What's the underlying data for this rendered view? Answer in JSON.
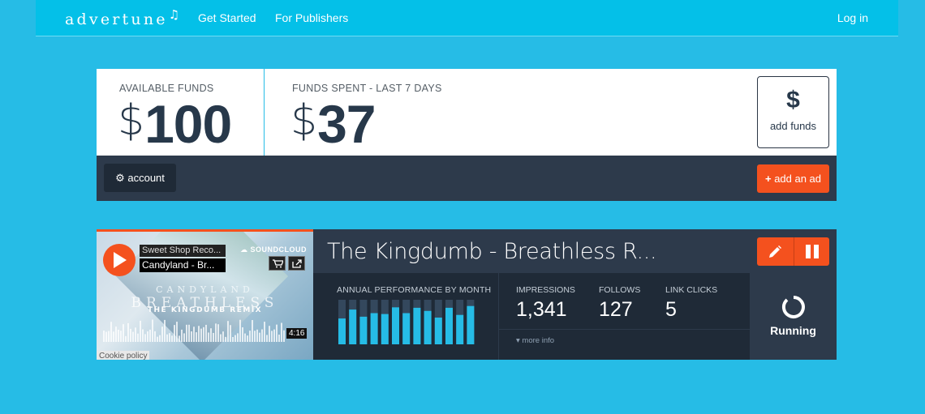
{
  "nav": {
    "logo": "advertune",
    "logo_note": "♫",
    "links": [
      "Get Started",
      "For Publishers"
    ],
    "login": "Log in"
  },
  "funds": {
    "available_label": "AVAILABLE FUNDS",
    "available_currency": "$",
    "available_amount": "100",
    "spent_label": "FUNDS SPENT - LAST 7 DAYS",
    "spent_currency": "$",
    "spent_amount": "37",
    "add_funds_symbol": "$",
    "add_funds_label": "add funds",
    "account_label": "account",
    "add_ad_label": "add an ad"
  },
  "ad": {
    "title": "The Kingdumb - Breathless R...",
    "player": {
      "artist": "Sweet Shop Reco...",
      "track": "Candyland - Br...",
      "brand": "SOUNDCLOUD",
      "art_line1": "CANDYLAND",
      "art_line2": "BREATHLESS",
      "art_line3": "THE KINGDUMB REMIX",
      "duration": "4:16",
      "cookie": "Cookie policy"
    },
    "performance_label": "ANNUAL PERFORMANCE BY MONTH",
    "monthly_performance": [
      0.58,
      0.78,
      0.62,
      0.7,
      0.68,
      0.83,
      0.7,
      0.82,
      0.75,
      0.6,
      0.82,
      0.66,
      0.86
    ],
    "stats": {
      "impressions_label": "IMPRESSIONS",
      "impressions": "1,341",
      "follows_label": "FOLLOWS",
      "follows": "127",
      "clicks_label": "LINK CLICKS",
      "clicks": "5"
    },
    "more_info": "more info",
    "status": "Running"
  },
  "colors": {
    "background": "#26bce6",
    "nav": "#04c0e8",
    "dark": "#2d3a4b",
    "darker": "#1f2a37",
    "accent": "#f4511e",
    "bar_active": "#26bce6",
    "bar_track": "#34485d"
  }
}
